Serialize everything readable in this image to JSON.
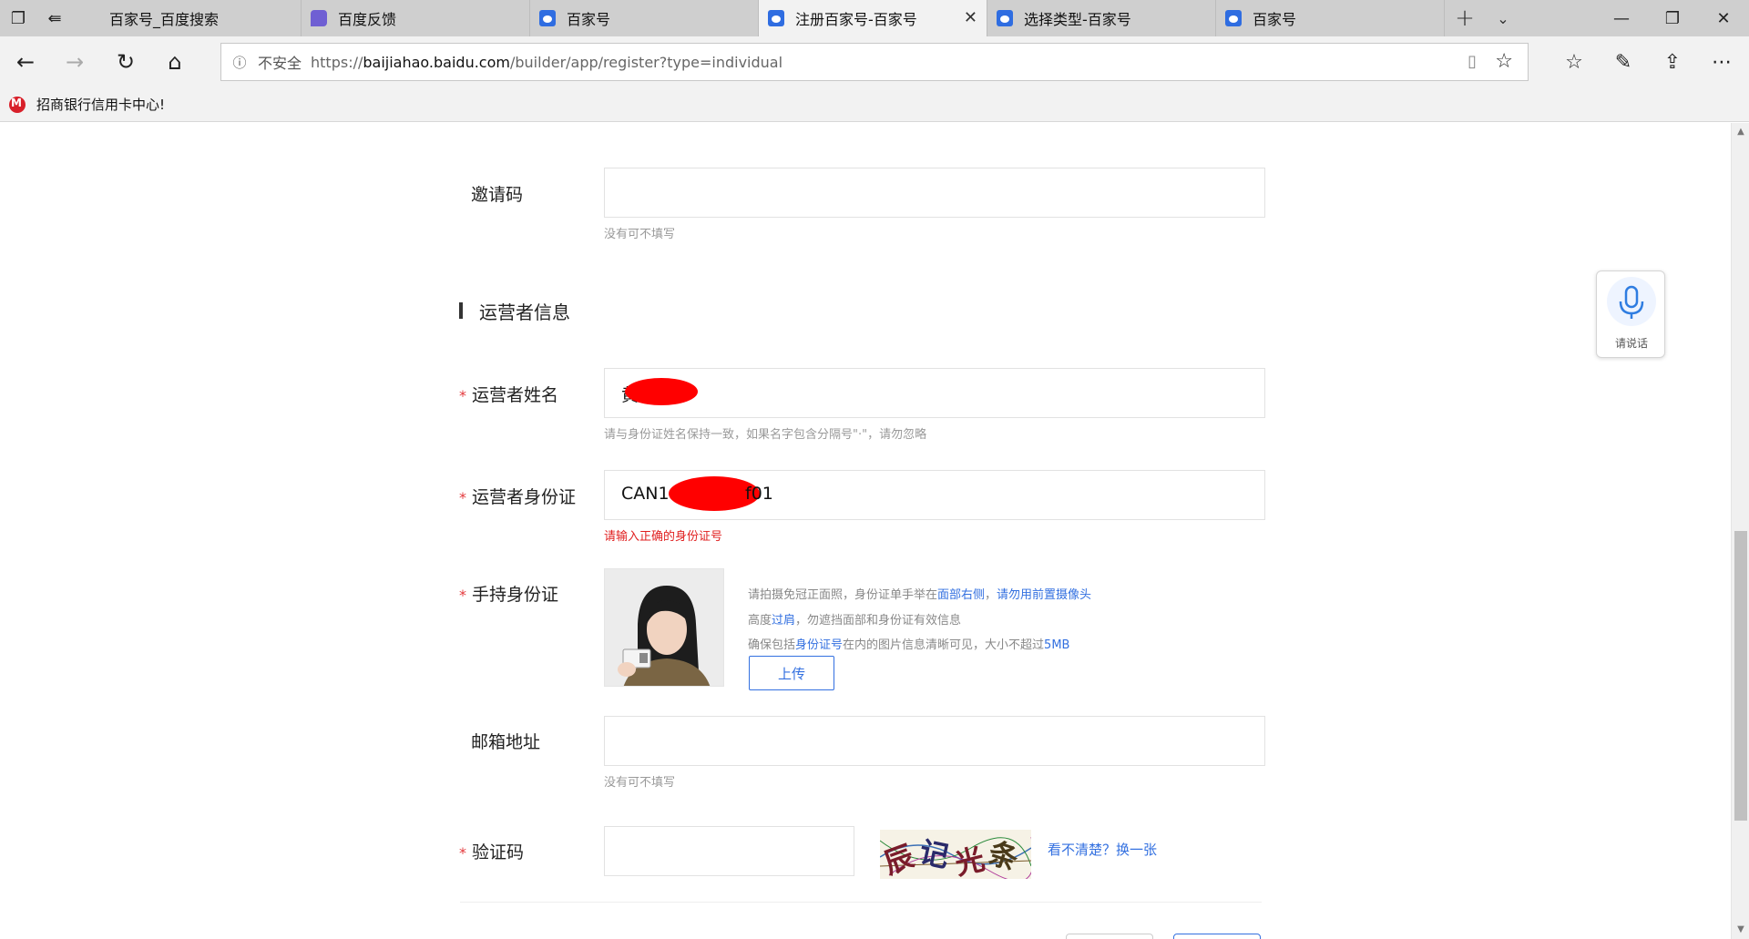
{
  "browser": {
    "tabs": [
      {
        "label": "百家号_百度搜索",
        "icon": "none",
        "active": false
      },
      {
        "label": "百度反馈",
        "icon": "feedback-icon",
        "active": false
      },
      {
        "label": "百家号",
        "icon": "baidu-paw-icon",
        "active": false
      },
      {
        "label": "注册百家号-百家号",
        "icon": "baidu-paw-icon",
        "active": true
      },
      {
        "label": "选择类型-百家号",
        "icon": "baidu-paw-icon",
        "active": false
      },
      {
        "label": "百家号",
        "icon": "baidu-paw-icon",
        "active": false
      }
    ],
    "address": {
      "insecure_label": "不安全",
      "url_prefix": "https://",
      "url_host": "baijiahao.baidu.com",
      "url_path": "/builder/app/register?type=individual"
    },
    "favorites": [
      {
        "label": "招商银行信用卡中心!",
        "icon": "cmb-logo-icon"
      }
    ]
  },
  "form": {
    "invite_code": {
      "label": "邀请码",
      "hint": "没有可不填写",
      "value": ""
    },
    "section_operator": {
      "title": "运营者信息"
    },
    "operator_name": {
      "label": "运营者姓名",
      "value": "黄",
      "hint": "请与身份证姓名保持一致，如果名字包含分隔号\"·\"，请勿忽略"
    },
    "operator_id": {
      "label": "运营者身份证",
      "value_start": "CAN1",
      "value_end": "f01",
      "error": "请输入正确的身份证号"
    },
    "handheld_id": {
      "label": "手持身份证",
      "tips": [
        {
          "parts": [
            "请拍摄免冠正面照，身份证单手举在",
            "面部右侧",
            "，",
            "请勿用前置摄像头"
          ]
        },
        {
          "parts": [
            "高度",
            "过肩",
            "，勿遮挡面部和身份证有效信息"
          ]
        },
        {
          "parts": [
            "确保包括",
            "身份证号",
            "在内的图片信息清晰可见，大小不超过",
            "5MB"
          ]
        }
      ],
      "upload_label": "上传"
    },
    "email": {
      "label": "邮箱地址",
      "hint": "没有可不填写",
      "value": ""
    },
    "captcha": {
      "label": "验证码",
      "value": "",
      "refresh_link": "看不清楚？换一张",
      "chars": [
        "辰",
        "记",
        "光",
        "条"
      ]
    }
  },
  "voice": {
    "label": "请说话"
  }
}
